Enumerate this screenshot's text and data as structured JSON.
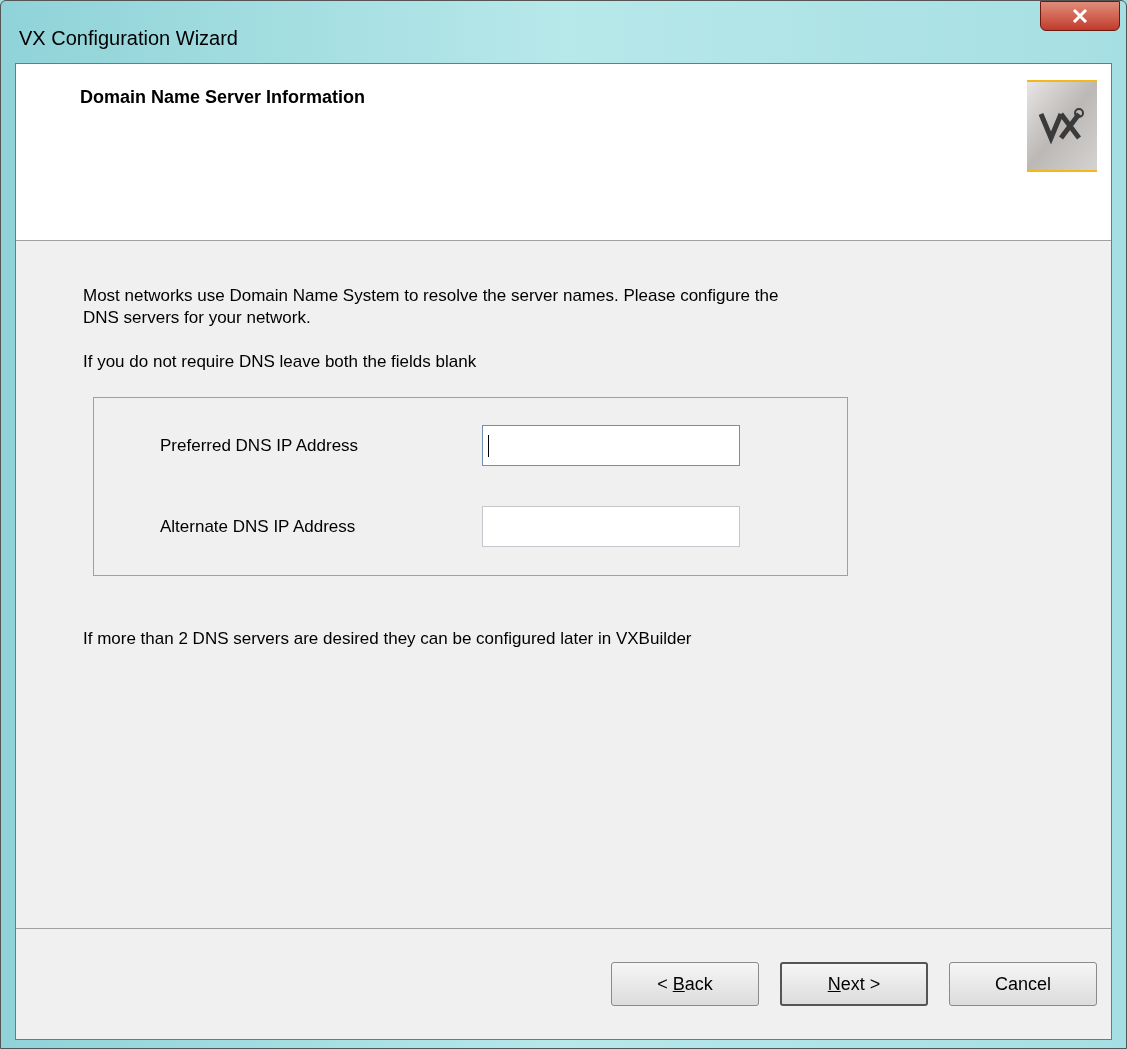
{
  "window": {
    "title": "VX Configuration Wizard"
  },
  "header": {
    "title": "Domain Name Server Information"
  },
  "intro": [
    "Most networks use Domain Name System to resolve the server names. Please configure the DNS servers for your network.",
    "If you do not require DNS leave both the fields blank"
  ],
  "fields": [
    {
      "label": "Preferred DNS IP Address",
      "focused": true
    },
    {
      "label": "Alternate DNS IP Address",
      "focused": false
    }
  ],
  "note": "If more than 2 DNS servers are desired they can be configured later in VXBuilder",
  "buttons": [
    {
      "before": "< ",
      "key": "B",
      "after": "ack",
      "default": false
    },
    {
      "key": "N",
      "after": "ext >",
      "default": true
    },
    {
      "after": "Cancel",
      "default": false
    }
  ]
}
